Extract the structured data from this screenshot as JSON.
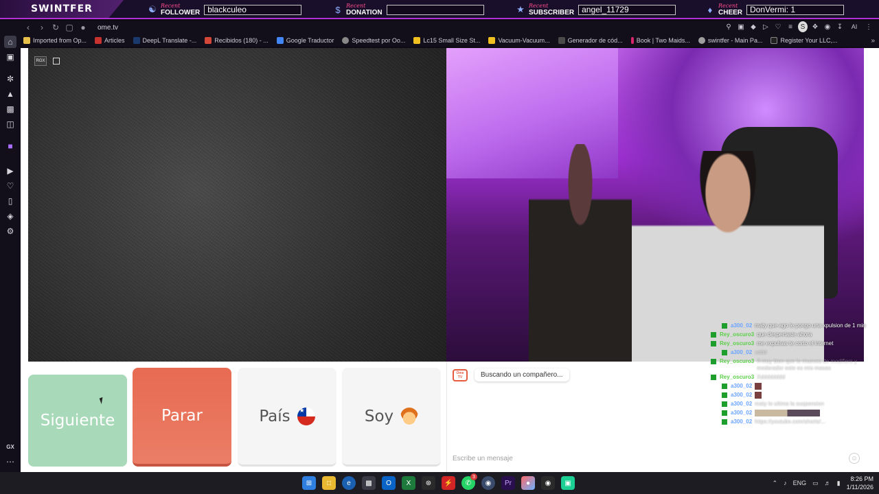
{
  "overlay": {
    "brand": "SWINTFER",
    "recent_word": "Recent",
    "groups": [
      {
        "kind": "FOLLOWER",
        "value": "blackculeo",
        "icon": "person-icon"
      },
      {
        "kind": "DONATION",
        "value": "",
        "icon": "dollar-icon"
      },
      {
        "kind": "SUBSCRIBER",
        "value": "angel_11729",
        "icon": "star-icon"
      },
      {
        "kind": "CHEER",
        "value": "DonVermi: 1",
        "icon": "gem-icon"
      }
    ]
  },
  "browser": {
    "url": "ome.tv",
    "gx_ai_label": "AI",
    "bookmarks": [
      {
        "label": "Imported from Op...",
        "color": "#e8c14a"
      },
      {
        "label": "Articles",
        "color": "#c8322e"
      },
      {
        "label": "DeepL Translate -...",
        "color": "#1a3a6e"
      },
      {
        "label": "Recibidos (180) - ...",
        "color": "#d44638"
      },
      {
        "label": "Google Traductor",
        "color": "#4285f4"
      },
      {
        "label": "Speedtest por Oo...",
        "color": "#888888"
      },
      {
        "label": "Lc15 Small Size St...",
        "color": "#f0c020"
      },
      {
        "label": "Vacuum-Vacuum...",
        "color": "#f0c020"
      },
      {
        "label": "Generador de cód...",
        "color": "#4a4a4a"
      },
      {
        "label": "Book | Two Maids...",
        "color": "#d6256b"
      },
      {
        "label": "swintfer - Main Pa...",
        "color": "#9e9e9e"
      },
      {
        "label": "Register Your LLC,...",
        "color": "#222222"
      }
    ],
    "sidebar_bottom_label": "GX"
  },
  "video_left": {
    "badge": "RGX"
  },
  "stream_chat": [
    {
      "user": "a300_02",
      "msg": "maty que ago le pongo una xpulsion de 1 min",
      "user_color": "blue",
      "faint": false,
      "indent": true
    },
    {
      "user": "Rey_oscuro3",
      "msg": "que despertaste ahora",
      "user_color": "green",
      "faint": false,
      "indent": false
    },
    {
      "user": "Rey_oscuro3",
      "msg": "me expulsas te corto el internet",
      "user_color": "green",
      "faint": false,
      "indent": false
    },
    {
      "user": "a300_02",
      "msg": "xddd",
      "user_color": "blue",
      "faint": true,
      "indent": true
    },
    {
      "user": "Rey_oscuro3",
      "msg": "A muy bien que lo mueves de modifiers y moderador este es mio masas",
      "user_color": "green",
      "faint": true,
      "indent": false
    },
    {
      "user": "Rey_oscuro3",
      "msg": "Xdddddddd",
      "user_color": "green",
      "faint": true,
      "indent": false
    },
    {
      "user": "a300_02",
      "msg": "",
      "user_color": "blue",
      "faint": false,
      "indent": true
    },
    {
      "user": "a300_02",
      "msg": "",
      "user_color": "blue",
      "faint": false,
      "indent": true
    },
    {
      "user": "a300_02",
      "msg": "maty lo ultima la suspension",
      "user_color": "blue",
      "faint": true,
      "indent": true
    },
    {
      "user": "a300_02",
      "msg": "",
      "user_color": "blue",
      "faint": false,
      "indent": true
    },
    {
      "user": "a300_02",
      "msg": "https://youtube.com/shorts/...",
      "user_color": "blue",
      "faint": true,
      "indent": true
    }
  ],
  "controls": {
    "next_label": "Siguiente",
    "stop_label": "Parar",
    "country_label": "País",
    "me_label": "Soy"
  },
  "chat": {
    "logo_text": "Ome TV",
    "status": "Buscando un compañero...",
    "input_placeholder": "Escribe un mensaje"
  },
  "taskbar": {
    "lang": "ENG",
    "time": "8:26 PM",
    "date": "1/11/2026",
    "whatsapp_badge": "3",
    "premiere_label": "Pr"
  },
  "colors": {
    "overlay_accent": "#b32fd6",
    "next_button": "#a8d9b8",
    "stop_button": "#e76b52"
  }
}
